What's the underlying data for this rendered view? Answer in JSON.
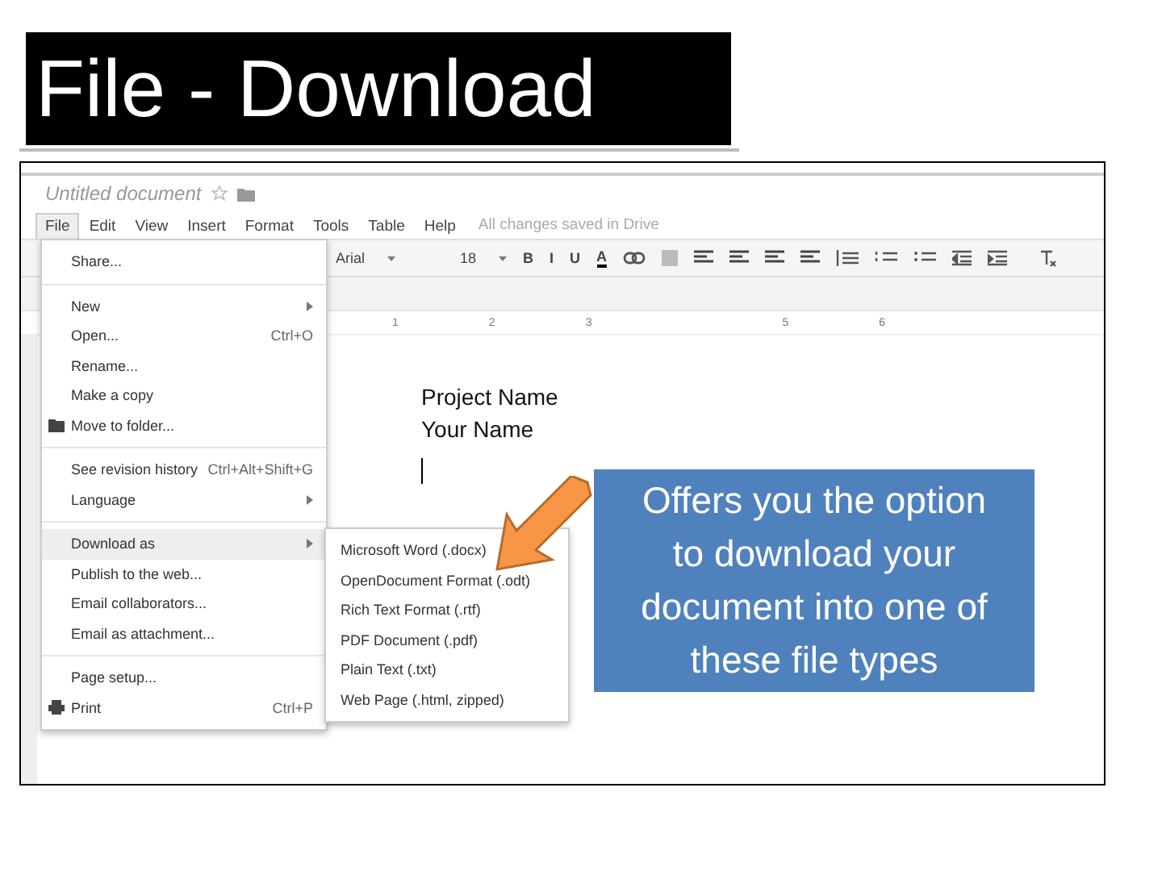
{
  "slide_title": "File - Download",
  "doc": {
    "title": "Untitled document",
    "menu": [
      {
        "label": "File",
        "selected": true
      },
      {
        "label": "Edit",
        "selected": false
      },
      {
        "label": "View",
        "selected": false
      },
      {
        "label": "Insert",
        "selected": false
      },
      {
        "label": "Format",
        "selected": false
      },
      {
        "label": "Tools",
        "selected": false
      },
      {
        "label": "Table",
        "selected": false
      },
      {
        "label": "Help",
        "selected": false
      }
    ],
    "status": "All changes saved in Drive",
    "toolbar": {
      "font": "Arial",
      "size": "18",
      "format_buttons": [
        "B",
        "I",
        "U",
        "A"
      ]
    },
    "ruler": [
      "1",
      "2",
      "3",
      "5",
      "6"
    ],
    "body": [
      "Project Name",
      "Your Name"
    ]
  },
  "file_menu": [
    {
      "kind": "item",
      "label": "Share..."
    },
    {
      "kind": "separator"
    },
    {
      "kind": "item",
      "label": "New",
      "submenu": true
    },
    {
      "kind": "item",
      "label": "Open...",
      "shortcut": "Ctrl+O"
    },
    {
      "kind": "item",
      "label": "Rename..."
    },
    {
      "kind": "item",
      "label": "Make a copy"
    },
    {
      "kind": "folder",
      "label": "Move to folder..."
    },
    {
      "kind": "separator"
    },
    {
      "kind": "item",
      "label": "See revision history",
      "shortcut": "Ctrl+Alt+Shift+G"
    },
    {
      "kind": "item",
      "label": "Language",
      "submenu": true
    },
    {
      "kind": "separator"
    },
    {
      "kind": "item",
      "label": "Download as",
      "submenu": true,
      "selected": true
    },
    {
      "kind": "item",
      "label": "Publish to the web..."
    },
    {
      "kind": "item",
      "label": "Email collaborators..."
    },
    {
      "kind": "item",
      "label": "Email as attachment..."
    },
    {
      "kind": "separator"
    },
    {
      "kind": "item",
      "label": "Page setup..."
    },
    {
      "kind": "print",
      "label": "Print",
      "shortcut": "Ctrl+P"
    }
  ],
  "download_menu": [
    "Microsoft Word (.docx)",
    "OpenDocument Format (.odt)",
    "Rich Text Format (.rtf)",
    "PDF Document (.pdf)",
    "Plain Text (.txt)",
    "Web Page (.html, zipped)"
  ],
  "callout": "Offers you the option to download your document into one of these file types"
}
